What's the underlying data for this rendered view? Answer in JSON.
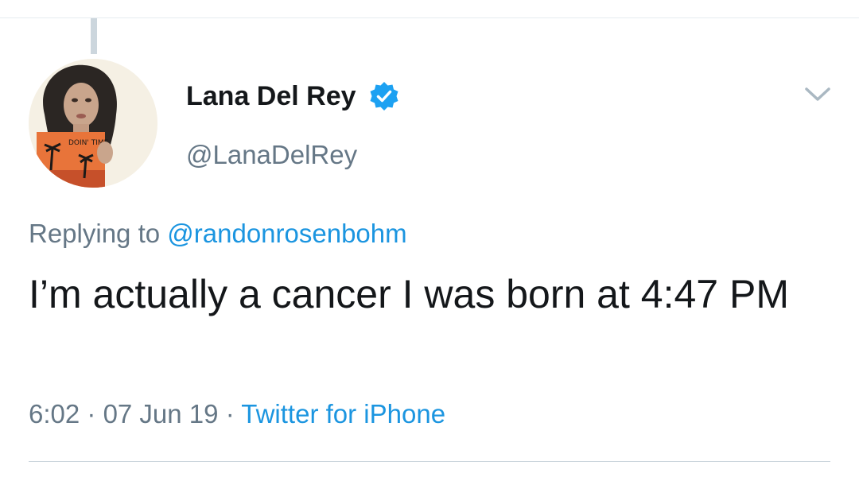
{
  "tweet": {
    "author": {
      "display_name": "Lana Del Rey",
      "handle": "@LanaDelRey",
      "verified": true,
      "avatar_shirt_text": "DOIN' TIME"
    },
    "replying_prefix": "Replying to ",
    "replying_to": "@randonrosenbohm",
    "text": "I’m actually a cancer I was born at 4:47 PM",
    "time": "6:02",
    "date": "07 Jun 19",
    "separator": " · ",
    "source": "Twitter for iPhone"
  },
  "icons": {
    "verified": "verified-badge-icon",
    "more": "chevron-down-icon"
  },
  "colors": {
    "text_primary": "#14171a",
    "text_secondary": "#657786",
    "link": "#1b95e0",
    "verified": "#1da1f2",
    "divider": "#ccd6dd"
  }
}
